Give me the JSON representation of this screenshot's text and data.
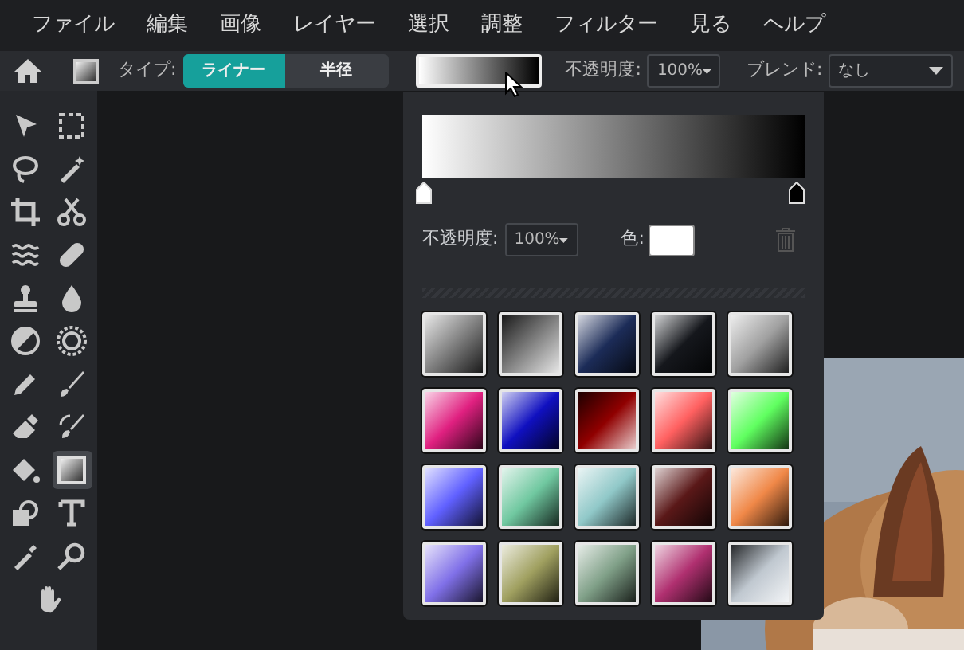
{
  "menu": [
    "ファイル",
    "編集",
    "画像",
    "レイヤー",
    "選択",
    "調整",
    "フィルター",
    "見る",
    "ヘルプ"
  ],
  "toolbar": {
    "type_label": "タイプ:",
    "types": [
      {
        "label": "ライナー",
        "selected": true
      },
      {
        "label": "半径",
        "selected": false
      }
    ],
    "opacity_label": "不透明度:",
    "opacity": "100%",
    "blend_label": "ブレンド:",
    "blend": "なし"
  },
  "tools": [
    {
      "kind": "pointer",
      "selected": false
    },
    {
      "kind": "marquee",
      "selected": false
    },
    {
      "kind": "lasso",
      "selected": false
    },
    {
      "kind": "wand",
      "selected": false
    },
    {
      "kind": "crop",
      "selected": false
    },
    {
      "kind": "scissors",
      "selected": false
    },
    {
      "kind": "waves",
      "selected": false
    },
    {
      "kind": "bandage",
      "selected": false
    },
    {
      "kind": "stamp",
      "selected": false
    },
    {
      "kind": "drop",
      "selected": false
    },
    {
      "kind": "dodge",
      "selected": false
    },
    {
      "kind": "sun",
      "selected": false
    },
    {
      "kind": "pen",
      "selected": false
    },
    {
      "kind": "brush",
      "selected": false
    },
    {
      "kind": "eraser",
      "selected": false
    },
    {
      "kind": "replace",
      "selected": false
    },
    {
      "kind": "bucket",
      "selected": false
    },
    {
      "kind": "gradient",
      "selected": true
    },
    {
      "kind": "shape",
      "selected": false
    },
    {
      "kind": "text",
      "selected": false
    },
    {
      "kind": "picker",
      "selected": false
    },
    {
      "kind": "zoom",
      "selected": false
    },
    {
      "kind": "hand",
      "selected": false
    }
  ],
  "popover": {
    "stops": [
      {
        "color": "#ffffff"
      },
      {
        "color": "#000000"
      }
    ],
    "opacity_label": "不透明度:",
    "opacity": "100%",
    "color_label": "色:",
    "color": "#ffffff",
    "presets": [
      {
        "color": "#808080",
        "reversed": false
      },
      {
        "color": "#808080",
        "reversed": true
      },
      {
        "color": "#1c2c58",
        "reversed": false
      },
      {
        "color": "#15171c",
        "reversed": false
      },
      {
        "color": "#a0a0a0",
        "reversed": false
      },
      {
        "color": "#e02080",
        "reversed": false
      },
      {
        "color": "#1010c0",
        "reversed": false
      },
      {
        "color": "#900000",
        "reversed": true
      },
      {
        "color": "#ff6060",
        "reversed": false
      },
      {
        "color": "#60ff60",
        "reversed": false
      },
      {
        "color": "#6060ff",
        "reversed": false
      },
      {
        "color": "#70c8a0",
        "reversed": false
      },
      {
        "color": "#90c8c8",
        "reversed": false
      },
      {
        "color": "#5a1818",
        "reversed": false
      },
      {
        "color": "#f08848",
        "reversed": false
      },
      {
        "color": "#8070e8",
        "reversed": false
      },
      {
        "color": "#a0a060",
        "reversed": false
      },
      {
        "color": "#80a088",
        "reversed": false
      },
      {
        "color": "#b03070",
        "reversed": false
      },
      {
        "color": "#c0c8d0",
        "reversed": true
      }
    ]
  }
}
